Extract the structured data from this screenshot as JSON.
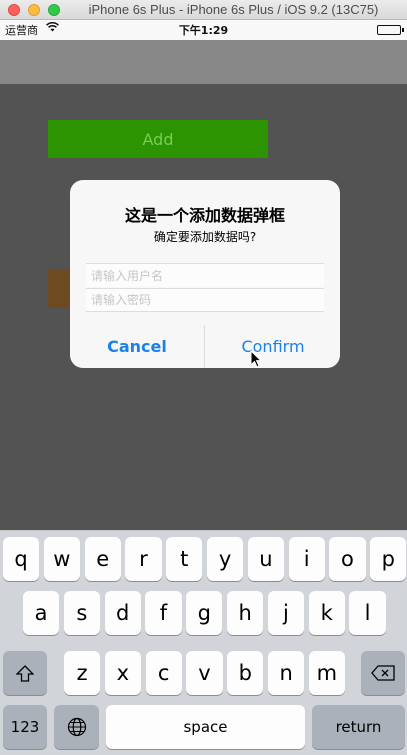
{
  "window": {
    "title": "iPhone 6s Plus - iPhone 6s Plus / iOS 9.2 (13C75)"
  },
  "status_bar": {
    "carrier": "运营商",
    "wifi_icon": "wifi-icon",
    "time": "下午1:29",
    "battery_level": 1.0
  },
  "screen": {
    "add_button_label": "Add"
  },
  "alert": {
    "title": "这是一个添加数据弹框",
    "message": "确定要添加数据吗?",
    "username_placeholder": "请输入用户名",
    "username_value": "",
    "password_placeholder": "请输入密码",
    "password_value": "",
    "cancel_label": "Cancel",
    "confirm_label": "Confirm",
    "button_color": "#1a82e8"
  },
  "keyboard": {
    "row1": [
      "q",
      "w",
      "e",
      "r",
      "t",
      "y",
      "u",
      "i",
      "o",
      "p"
    ],
    "row2": [
      "a",
      "s",
      "d",
      "f",
      "g",
      "h",
      "j",
      "k",
      "l"
    ],
    "row3": [
      "z",
      "x",
      "c",
      "v",
      "b",
      "n",
      "m"
    ],
    "shift_icon": "shift-icon",
    "backspace_icon": "backspace-icon",
    "numbers_label": "123",
    "globe_icon": "globe-icon",
    "space_label": "space",
    "return_label": "return"
  }
}
